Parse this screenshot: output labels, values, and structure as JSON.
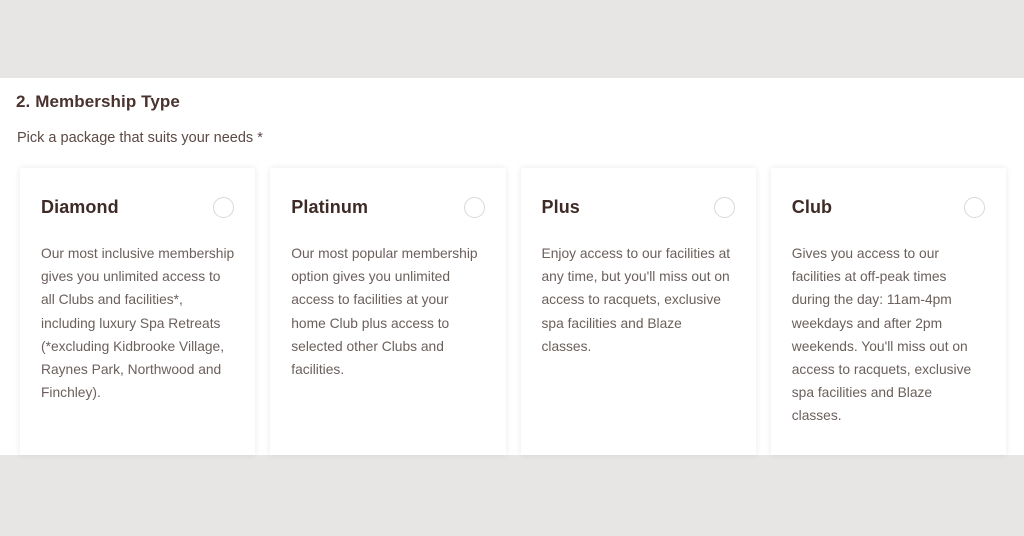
{
  "section": {
    "heading": "2. Membership Type",
    "subheading": "Pick a package that suits your needs *"
  },
  "colors": {
    "band_background": "#e8e6e4",
    "content_background": "#ffffff",
    "heading_text": "#4a332e",
    "card_title_text": "#3f2b26",
    "body_text": "#6b605c",
    "radio_border": "#dcd8d6"
  },
  "cards": [
    {
      "title": "Diamond",
      "description": "Our most inclusive membership gives you unlimited access to all Clubs and facilities*, including luxury Spa Retreats (*excluding Kidbrooke Village, Raynes Park, Northwood and Finchley).",
      "radio_icon": "radio-unchecked-icon",
      "selected": false
    },
    {
      "title": "Platinum",
      "description": "Our most popular membership option gives you unlimited access to facilities at your home Club plus access to selected other Clubs and facilities.",
      "radio_icon": "radio-unchecked-icon",
      "selected": false
    },
    {
      "title": "Plus",
      "description": "Enjoy access to our facilities at any time, but you'll miss out on access to racquets, exclusive spa facilities and Blaze classes.",
      "radio_icon": "radio-unchecked-icon",
      "selected": false
    },
    {
      "title": "Club",
      "description": "Gives you access to our facilities at off-peak times during the day: 11am-4pm weekdays and after 2pm weekends. You'll miss out on access to racquets, exclusive spa facilities and Blaze classes.",
      "radio_icon": "radio-unchecked-icon",
      "selected": false
    }
  ]
}
